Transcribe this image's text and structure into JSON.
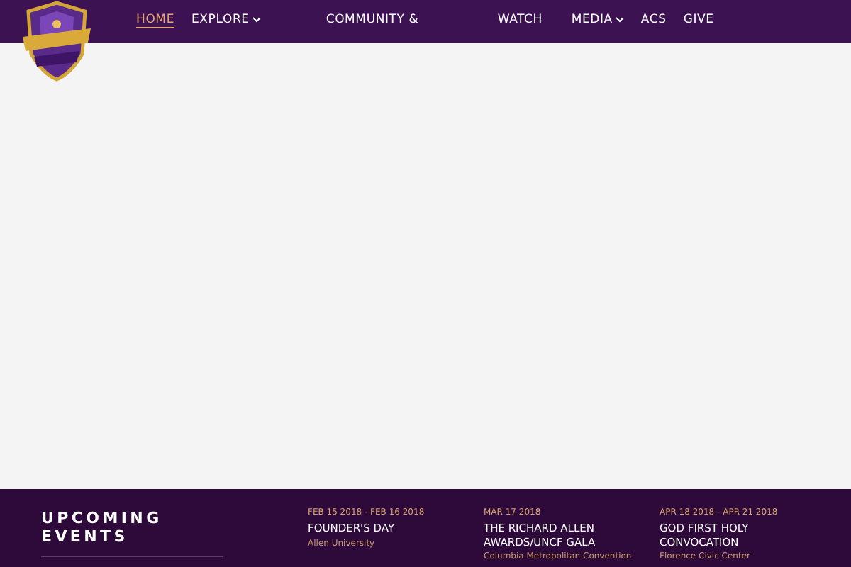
{
  "nav": {
    "items": [
      {
        "label": "HOME",
        "selected": true,
        "dropdown": false
      },
      {
        "label": "EXPLORE",
        "selected": false,
        "dropdown": true
      },
      {
        "label": "COMMUNITY &",
        "selected": false,
        "dropdown": false
      },
      {
        "label": "WATCH",
        "selected": false,
        "dropdown": false
      },
      {
        "label": "MEDIA",
        "selected": false,
        "dropdown": true
      },
      {
        "label": "ACS",
        "selected": false,
        "dropdown": false
      },
      {
        "label": "GIVE",
        "selected": false,
        "dropdown": false
      }
    ]
  },
  "upcoming_events": {
    "heading": "UPCOMING EVENTS",
    "events": [
      {
        "date": "FEB 15 2018 - FEB 16 2018",
        "title": "FOUNDER'S DAY",
        "venue": "Allen University"
      },
      {
        "date": "MAR 17 2018",
        "title": "THE RICHARD ALLEN AWARDS/UNCF GALA",
        "venue": "Columbia Metropolitan Convention"
      },
      {
        "date": "APR 18 2018 - APR 21 2018",
        "title": "GOD FIRST HOLY CONVOCATION",
        "venue": "Florence Civic Center"
      }
    ]
  }
}
